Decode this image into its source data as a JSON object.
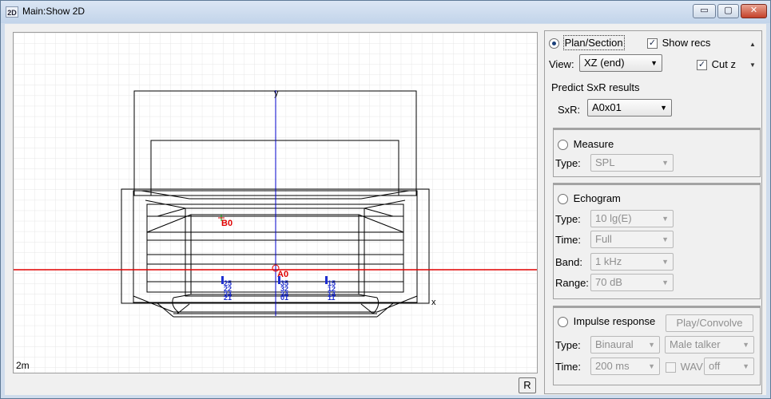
{
  "window": {
    "icon_text": "2D",
    "title": "Main:Show 2D",
    "minimize_glyph": "▭",
    "maximize_glyph": "▢",
    "close_glyph": "✕"
  },
  "viewport": {
    "scale_label": "2m",
    "axis_x_label": "x",
    "axis_y_label": "y",
    "source_labels": [
      "A0",
      "B0"
    ],
    "receiver_labels": [
      "35",
      "32",
      "34",
      "25",
      "22",
      "24",
      "15",
      "12",
      "14",
      "11",
      "01",
      "21"
    ],
    "r_button_label": "R"
  },
  "panel": {
    "plan_section_label": "Plan/Section",
    "plan_section_selected": true,
    "show_recs_label": "Show recs",
    "show_recs_checked": true,
    "view_label": "View:",
    "view_value": "XZ (end)",
    "cut_z_label": "Cut z",
    "cut_z_checked": true,
    "predict_title": "Predict SxR results",
    "sxr_label": "SxR:",
    "sxr_value": "A0x01",
    "measure": {
      "label": "Measure",
      "type_label": "Type:",
      "type_value": "SPL"
    },
    "echogram": {
      "label": "Echogram",
      "type_label": "Type:",
      "type_value": "10 lg(E)",
      "time_label": "Time:",
      "time_value": "Full",
      "band_label": "Band:",
      "band_value": "1 kHz",
      "range_label": "Range:",
      "range_value": "70 dB"
    },
    "impulse": {
      "label": "Impulse response",
      "play_button": "Play/Convolve",
      "type_label": "Type:",
      "type_value": "Binaural",
      "talker_value": "Male talker",
      "time_label": "Time:",
      "time_value": "200 ms",
      "wav_label": "WAV",
      "wav_checked": false,
      "wav_value": "off"
    }
  },
  "colors": {
    "grid": "#e6e6e6",
    "x_axis": "#e00000",
    "y_axis": "#0000cc",
    "geometry": "#000000",
    "source": "#e00000",
    "receiver": "#1f2fd0"
  }
}
